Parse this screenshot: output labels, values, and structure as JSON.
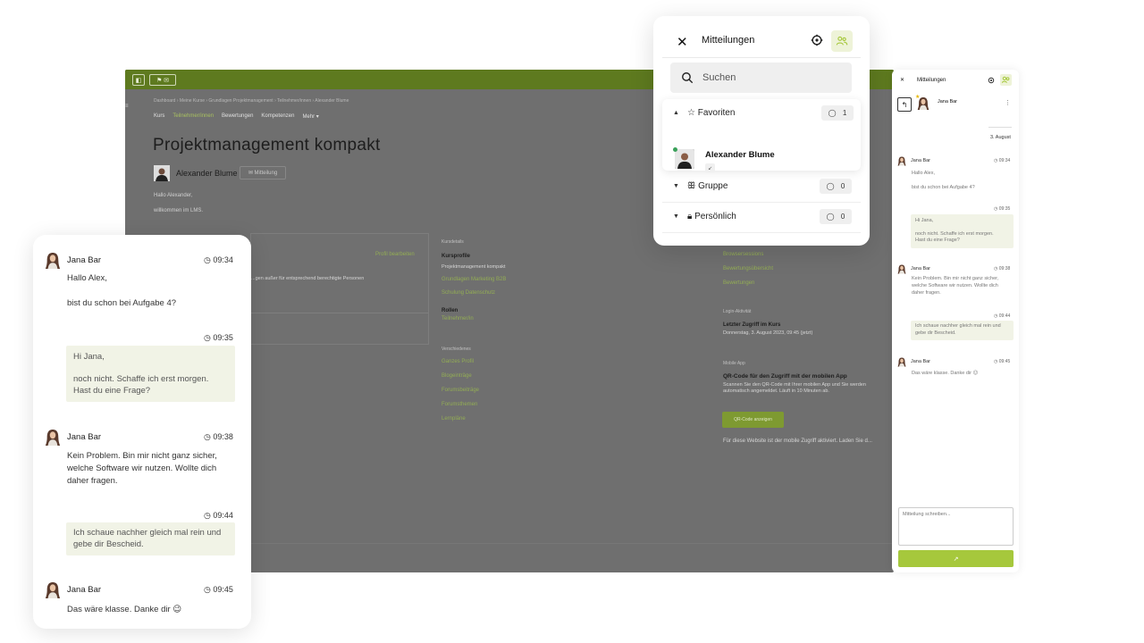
{
  "lms": {
    "toolbar": {
      "btn1": "◧",
      "btn2": "⚑ ✉"
    },
    "side_tab": "≡",
    "breadcrumb": "Dashboard  ›  Meine Kurse  ›  Grundlagen Projektmanagement  ›  Teilnehmer/innen  ›  Alexander Blume",
    "tabs": [
      "Kurs",
      "Teilnehmer/innen",
      "Bewertungen",
      "Kompetenzen",
      "Mehr ▾"
    ],
    "title": "Projektmanagement kompakt",
    "user_name": "Alexander Blume",
    "message_button": "✉ Mitteilung",
    "greeting_line1": "Hallo Alexander,",
    "greeting_line2": "willkommen im LMS.",
    "profile_edit": "Profil bearbeiten",
    "email_note": "...gen außer für entsprechend berechtigte Personen",
    "course_details_label": "Kursdetails",
    "course_profiles_label": "Kursprofile",
    "course_profile_value": "Projektmanagement kompakt",
    "course_links": [
      "Grundlagen Marketing B2B",
      "Schulung Datenschutz"
    ],
    "roles_label": "Rollen",
    "roles_value": "Teilnehmer/in",
    "misc_label": "Verschiedenes",
    "misc_links": [
      "Ganzes Profil",
      "Blogeinträge",
      "Forumsbeiträge",
      "Forumsthemen",
      "Lernpläne"
    ],
    "right_links": [
      "Browsersessions",
      "Bewertungsübersicht",
      "Bewertungen"
    ],
    "login_label": "Login-Aktivität",
    "last_access_label": "Letzter Zugriff im Kurs",
    "last_access_value": "Donnerstag, 3. August 2023, 09:45 (jetzt)",
    "mobile_label": "Mobile App",
    "mobile_title": "QR-Code für den Zugriff mit der mobilen App",
    "mobile_desc": "Scannen Sie den QR-Code mit Ihrer mobilen App und Sie werden automatisch angemeldet. Läuft in 10 Minuten ab.",
    "qr_button": "QR-Code anzeigen",
    "mobile_footer": "Für diese Website ist der mobile Zugriff aktiviert. Laden Sie d..."
  },
  "popup": {
    "close": "✕",
    "title": "Mitteilungen",
    "search_placeholder": "Suchen",
    "sections": [
      {
        "label": "Favoriten",
        "count": "1"
      },
      {
        "label": "Gruppe",
        "count": "0"
      },
      {
        "label": "Persönlich",
        "count": "0"
      }
    ],
    "favorite_contact": "Alexander Blume"
  },
  "rpanel": {
    "close": "✕",
    "title": "Mitteilungen",
    "contact": "Jana Bar",
    "menu": "⋮",
    "date": "3. August",
    "input_placeholder": "Mitteilung schreiben...",
    "send": "↗"
  },
  "chat": {
    "messages": [
      {
        "sender": "Jana Bar",
        "time": "◷ 09:34",
        "lines": [
          "Hallo Alex,",
          "bist du schon bei Aufgabe 4?"
        ]
      },
      {
        "time": "◷ 09:35",
        "lines": [
          "Hi Jana,",
          "noch nicht. Schaffe ich erst morgen.",
          "Hast du eine Frage?"
        ]
      },
      {
        "sender": "Jana Bar",
        "time": "◷ 09:38",
        "lines": [
          "Kein Problem. Bin mir nicht ganz sicher,",
          "welche Software wir nutzen. Wollte dich",
          "daher fragen."
        ]
      },
      {
        "time": "◷ 09:44",
        "lines": [
          "Ich schaue nachher gleich mal rein und",
          "gebe dir Bescheid."
        ]
      },
      {
        "sender": "Jana Bar",
        "time": "◷ 09:45",
        "lines": [
          "Das wäre klasse. Danke dir"
        ]
      }
    ],
    "emoji": "😉"
  },
  "colors": {
    "accent": "#a6c83c",
    "accent_dark": "#5e7a1f",
    "bubble": "#f1f3e6"
  }
}
